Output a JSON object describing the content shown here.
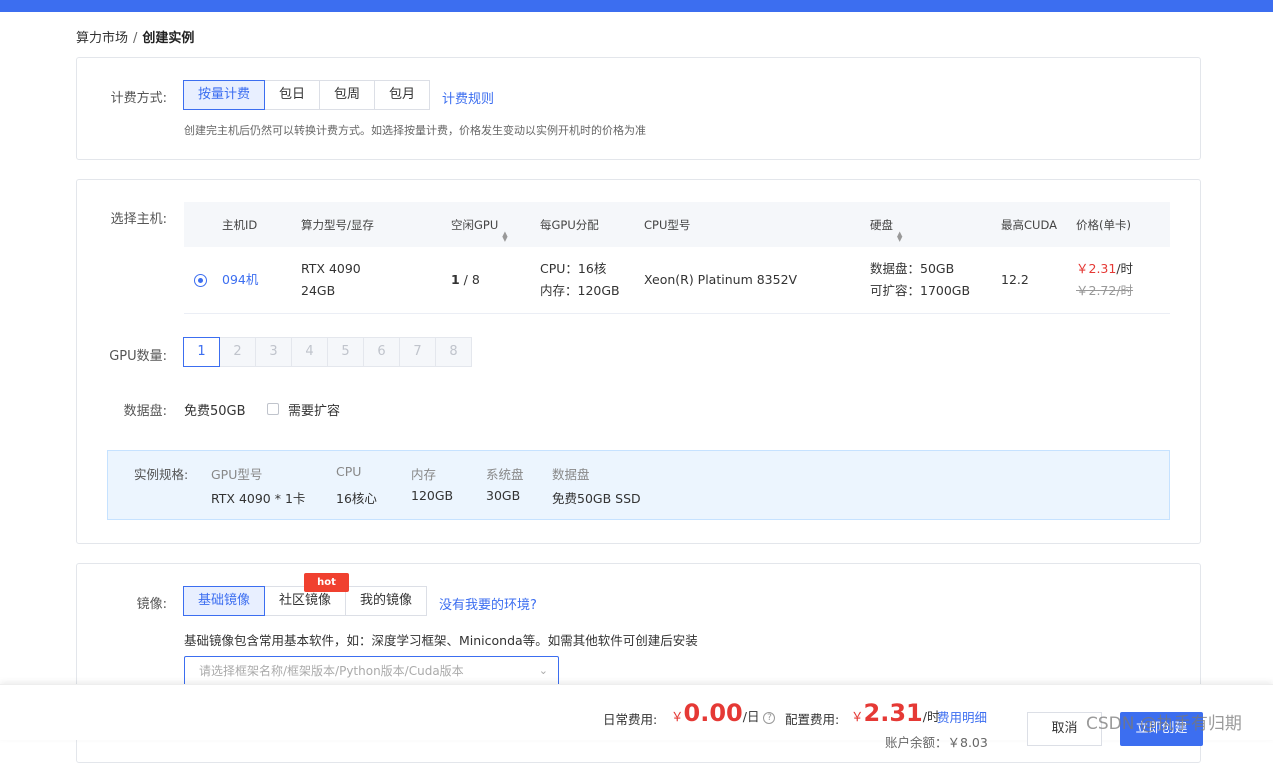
{
  "breadcrumb": {
    "parent": "算力市场",
    "separator": "/",
    "current": "创建实例"
  },
  "billing": {
    "label": "计费方式:",
    "options": [
      "按量计费",
      "包日",
      "包周",
      "包月"
    ],
    "selected": "按量计费",
    "rules_link": "计费规则",
    "hint": "创建完主机后仍然可以转换计费方式。如选择按量计费，价格发生变动以实例开机时的价格为准"
  },
  "host": {
    "label": "选择主机:",
    "columns": {
      "id": "主机ID",
      "model": "算力型号/显存",
      "free_gpu": "空闲GPU",
      "per_gpu": "每GPU分配",
      "cpu_model": "CPU型号",
      "disk": "硬盘",
      "cuda": "最高CUDA",
      "price": "价格(单卡)"
    },
    "row": {
      "id": "094机",
      "model": "RTX 4090",
      "vram": "24GB",
      "free_gpu": "1",
      "total_gpu": " / 8",
      "cpu_alloc": "CPU：16核",
      "mem_alloc": "内存：120GB",
      "cpu_model": "Xeon(R) Platinum 8352V",
      "data_disk": "数据盘：50GB",
      "expandable": "可扩容：1700GB",
      "cuda": "12.2",
      "price_now": "￥2.31",
      "price_unit": "/时",
      "price_old": "￥2.72/时"
    }
  },
  "gpu_count": {
    "label": "GPU数量:",
    "options": [
      "1",
      "2",
      "3",
      "4",
      "5",
      "6",
      "7",
      "8"
    ],
    "selected": "1"
  },
  "data_disk": {
    "label": "数据盘:",
    "value": "免费50GB",
    "expand_label": "需要扩容",
    "expand_checked": false
  },
  "spec": {
    "label": "实例规格:",
    "headers": [
      "GPU型号",
      "CPU",
      "内存",
      "系统盘",
      "数据盘"
    ],
    "values": [
      "RTX 4090 * 1卡",
      "16核心",
      "120GB",
      "30GB",
      "免费50GB SSD"
    ]
  },
  "image": {
    "label": "镜像:",
    "tabs": [
      "基础镜像",
      "社区镜像",
      "我的镜像"
    ],
    "selected": "基础镜像",
    "hot_badge": "hot",
    "env_link": "没有我要的环境?",
    "hint": "基础镜像包含常用基本软件，如：深度学习框架、Miniconda等。如需其他软件可创建后安装",
    "select_placeholder": "请选择框架名称/框架版本/Python版本/Cuda版本"
  },
  "footer": {
    "daily_label": "日常费用:",
    "daily_currency": "￥",
    "daily_value": "0.00",
    "daily_unit": "/日",
    "config_label": "配置费用:",
    "config_currency": "￥",
    "config_value": "2.31",
    "config_unit": "/时",
    "detail_link": "费用明细",
    "balance_partial": "账户余额：￥8.03",
    "cancel": "取消",
    "create": "立即创建"
  },
  "watermark": "CSDN @执手有归期",
  "colors": {
    "accent": "#3c6ef0",
    "price_red": "#e53935",
    "hot_badge": "#f0402f",
    "spec_bg": "#ecf5fe"
  }
}
